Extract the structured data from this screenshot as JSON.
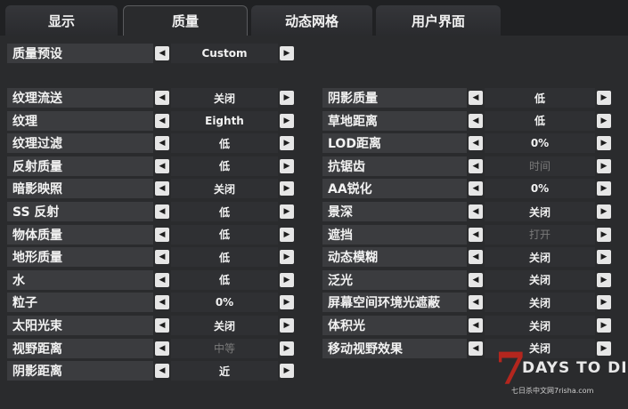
{
  "tabs": [
    {
      "label": "显示"
    },
    {
      "label": "质量"
    },
    {
      "label": "动态网格"
    },
    {
      "label": "用户界面"
    }
  ],
  "preset": {
    "label": "质量预设",
    "value": "Custom"
  },
  "left": [
    {
      "label": "纹理流送",
      "value": "关闭",
      "disabled": false
    },
    {
      "label": "纹理",
      "value": "Eighth",
      "disabled": false
    },
    {
      "label": "纹理过滤",
      "value": "低",
      "disabled": false
    },
    {
      "label": "反射质量",
      "value": "低",
      "disabled": false
    },
    {
      "label": "暗影映照",
      "value": "关闭",
      "disabled": false
    },
    {
      "label": "SS 反射",
      "value": "低",
      "disabled": false
    },
    {
      "label": "物体质量",
      "value": "低",
      "disabled": false
    },
    {
      "label": "地形质量",
      "value": "低",
      "disabled": false
    },
    {
      "label": "水",
      "value": "低",
      "disabled": false
    },
    {
      "label": "粒子",
      "value": "0%",
      "disabled": false
    },
    {
      "label": "太阳光束",
      "value": "关闭",
      "disabled": false
    },
    {
      "label": "视野距离",
      "value": "中等",
      "disabled": true
    },
    {
      "label": "阴影距离",
      "value": "近",
      "disabled": false
    }
  ],
  "right": [
    {
      "label": "阴影质量",
      "value": "低",
      "disabled": false
    },
    {
      "label": "草地距离",
      "value": "低",
      "disabled": false
    },
    {
      "label": "LOD距离",
      "value": "0%",
      "disabled": false
    },
    {
      "label": "抗锯齿",
      "value": "时间",
      "disabled": true
    },
    {
      "label": "AA锐化",
      "value": "0%",
      "disabled": false
    },
    {
      "label": "景深",
      "value": "关闭",
      "disabled": false
    },
    {
      "label": "遮挡",
      "value": "打开",
      "disabled": true
    },
    {
      "label": "动态模糊",
      "value": "关闭",
      "disabled": false
    },
    {
      "label": "泛光",
      "value": "关闭",
      "disabled": false
    },
    {
      "label": "屏幕空间环境光遮蔽",
      "value": "关闭",
      "disabled": false
    },
    {
      "label": "体积光",
      "value": "关闭",
      "disabled": false
    },
    {
      "label": "移动视野效果",
      "value": "关闭",
      "disabled": false
    }
  ],
  "logo": {
    "seven": "7",
    "word": "DAYS TO DIE",
    "sub": "七日杀中文网7risha.com"
  },
  "icons": {
    "left_arrow": "◀",
    "right_arrow": "▶"
  }
}
